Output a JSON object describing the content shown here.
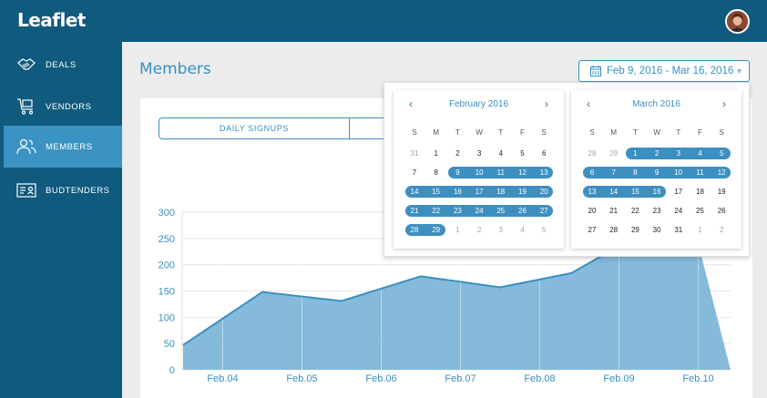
{
  "app": {
    "name": "Leaflet"
  },
  "sidebar": {
    "items": [
      {
        "label": "DEALS",
        "icon": "handshake-icon"
      },
      {
        "label": "VENDORS",
        "icon": "cart-icon"
      },
      {
        "label": "MEMBERS",
        "icon": "people-icon",
        "active": true
      },
      {
        "label": "BUDTENDERS",
        "icon": "id-card-icon"
      }
    ]
  },
  "page": {
    "title": "Members"
  },
  "date_range": {
    "label": "Feb 9, 2016 - Mar 16, 2016"
  },
  "tabs": [
    {
      "label": "DAILY SIGNUPS"
    },
    {
      "label": ""
    }
  ],
  "calendars": [
    {
      "title": "February 2016",
      "weekdays": [
        "S",
        "M",
        "T",
        "W",
        "T",
        "F",
        "S"
      ],
      "weeks": [
        [
          "31",
          "1",
          "2",
          "3",
          "4",
          "5",
          "6"
        ],
        [
          "7",
          "8",
          "9",
          "10",
          "11",
          "12",
          "13"
        ],
        [
          "14",
          "15",
          "16",
          "17",
          "18",
          "19",
          "20"
        ],
        [
          "21",
          "22",
          "23",
          "24",
          "25",
          "26",
          "27"
        ],
        [
          "28",
          "29",
          "1",
          "2",
          "3",
          "4",
          "5"
        ]
      ],
      "muted": [
        [
          0,
          0
        ],
        [
          4,
          2
        ],
        [
          4,
          3
        ],
        [
          4,
          4
        ],
        [
          4,
          5
        ],
        [
          4,
          6
        ]
      ],
      "selected_bands": [
        [
          1,
          2,
          6
        ],
        [
          2,
          0,
          6
        ],
        [
          3,
          0,
          6
        ],
        [
          4,
          0,
          1
        ]
      ]
    },
    {
      "title": "March 2016",
      "weekdays": [
        "S",
        "M",
        "T",
        "W",
        "T",
        "F",
        "S"
      ],
      "weeks": [
        [
          "28",
          "29",
          "1",
          "2",
          "3",
          "4",
          "5"
        ],
        [
          "6",
          "7",
          "8",
          "9",
          "10",
          "11",
          "12"
        ],
        [
          "13",
          "14",
          "15",
          "16",
          "17",
          "18",
          "19"
        ],
        [
          "20",
          "21",
          "22",
          "23",
          "24",
          "25",
          "26"
        ],
        [
          "27",
          "28",
          "29",
          "30",
          "31",
          "1",
          "2"
        ]
      ],
      "muted": [
        [
          0,
          0
        ],
        [
          0,
          1
        ],
        [
          4,
          5
        ],
        [
          4,
          6
        ]
      ],
      "selected_bands": [
        [
          0,
          2,
          6
        ],
        [
          1,
          0,
          6
        ],
        [
          2,
          0,
          3
        ]
      ]
    }
  ],
  "chart_data": {
    "type": "area",
    "x": [
      "Feb.04",
      "Feb.05",
      "Feb.06",
      "Feb.07",
      "Feb.08",
      "Feb.09",
      "Feb.10"
    ],
    "y_ticks": [
      300,
      250,
      200,
      150,
      100,
      50,
      0
    ],
    "ylim": [
      0,
      300
    ],
    "points": [
      [
        0,
        47
      ],
      [
        1,
        148
      ],
      [
        2,
        131
      ],
      [
        3,
        178
      ],
      [
        4,
        157
      ],
      [
        4.9,
        184
      ],
      [
        5.55,
        240
      ],
      [
        6.5,
        240
      ]
    ],
    "fill": "#7eb6d9",
    "line": "#3a8fc0",
    "label_color": "#3a8fc0"
  }
}
